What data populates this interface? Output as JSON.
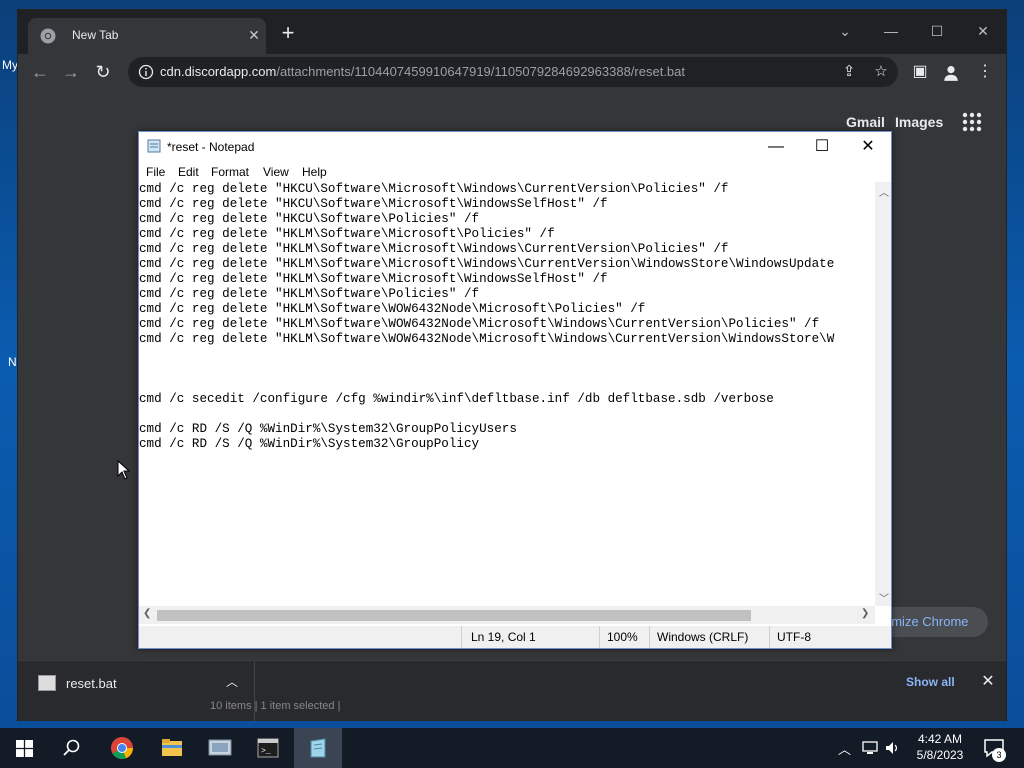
{
  "desktop": {
    "peek_my": "My",
    "peek_n": "N"
  },
  "chrome": {
    "tab_title": "New Tab",
    "tab_close": "✕",
    "new_tab": "+",
    "url_host": "cdn.discordapp.com",
    "url_path": "/attachments/1104407459910647919/1105079284692963388/reset.bat",
    "gmail": "Gmail",
    "images": "Images",
    "customize": "omize Chrome",
    "download_name": "reset.bat",
    "show_all": "Show all",
    "explorer_peek": "10 items  |  1 item selected  |"
  },
  "notepad": {
    "title": "*reset - Notepad",
    "menu": [
      "File",
      "Edit",
      "Format",
      "View",
      "Help"
    ],
    "content": "cmd /c reg delete \"HKCU\\Software\\Microsoft\\Windows\\CurrentVersion\\Policies\" /f\ncmd /c reg delete \"HKCU\\Software\\Microsoft\\WindowsSelfHost\" /f\ncmd /c reg delete \"HKCU\\Software\\Policies\" /f\ncmd /c reg delete \"HKLM\\Software\\Microsoft\\Policies\" /f\ncmd /c reg delete \"HKLM\\Software\\Microsoft\\Windows\\CurrentVersion\\Policies\" /f\ncmd /c reg delete \"HKLM\\Software\\Microsoft\\Windows\\CurrentVersion\\WindowsStore\\WindowsUpdate\ncmd /c reg delete \"HKLM\\Software\\Microsoft\\WindowsSelfHost\" /f\ncmd /c reg delete \"HKLM\\Software\\Policies\" /f\ncmd /c reg delete \"HKLM\\Software\\WOW6432Node\\Microsoft\\Policies\" /f\ncmd /c reg delete \"HKLM\\Software\\WOW6432Node\\Microsoft\\Windows\\CurrentVersion\\Policies\" /f\ncmd /c reg delete \"HKLM\\Software\\WOW6432Node\\Microsoft\\Windows\\CurrentVersion\\WindowsStore\\W\n\n\n\ncmd /c secedit /configure /cfg %windir%\\inf\\defltbase.inf /db defltbase.sdb /verbose\n\ncmd /c RD /S /Q %WinDir%\\System32\\GroupPolicyUsers\ncmd /c RD /S /Q %WinDir%\\System32\\GroupPolicy\n",
    "status_pos": "Ln 19, Col 1",
    "status_zoom": "100%",
    "status_eol": "Windows (CRLF)",
    "status_enc": "UTF-8"
  },
  "taskbar": {
    "time": "4:42 AM",
    "date": "5/8/2023",
    "notifications": "3"
  },
  "icons": [
    "chrome-icon",
    "info-icon",
    "share-icon",
    "star-icon",
    "sidebar-icon",
    "profile-icon",
    "menu-icon",
    "apps-grid-icon",
    "notepad-icon",
    "windows-start-icon",
    "search-icon",
    "file-explorer-icon",
    "terminal-icon",
    "network-icon",
    "volume-icon",
    "notification-icon"
  ]
}
